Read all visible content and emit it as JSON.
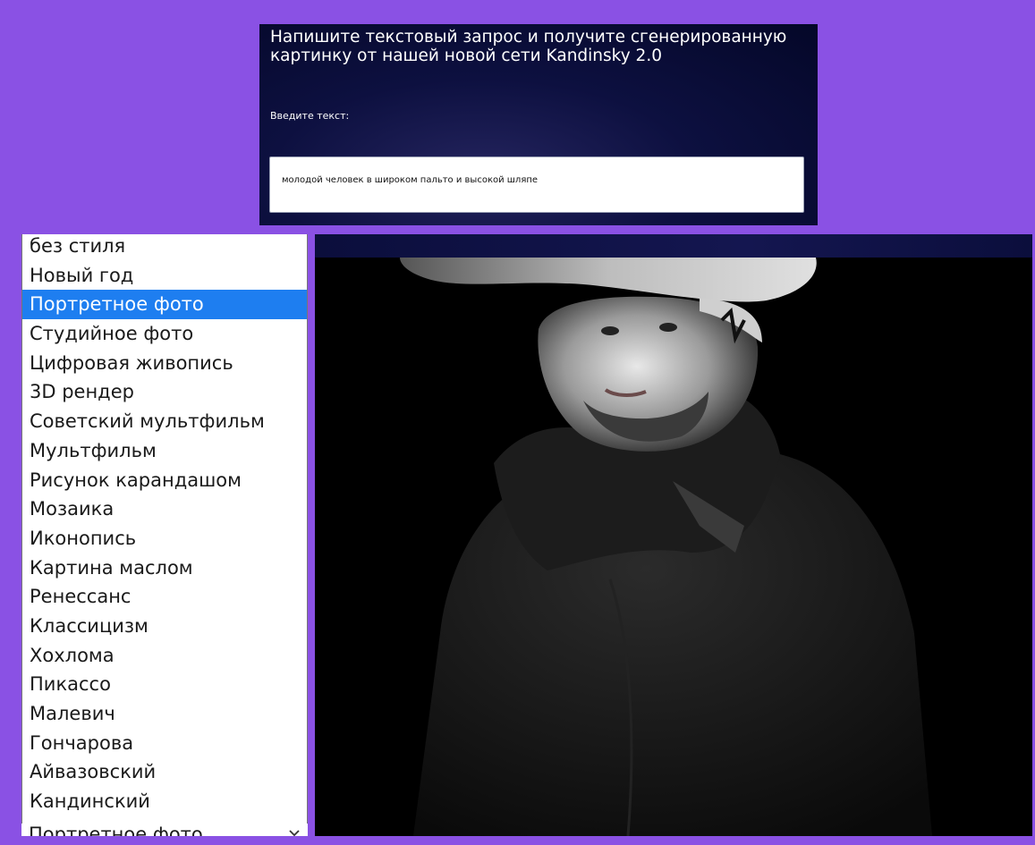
{
  "prompt_panel": {
    "title": "Напишите текстовый запрос и получите сгенерированную картинку от нашей новой сети Kandinsky 2.0",
    "input_label": "Введите текст:",
    "input_value": "молодой человек в широком пальто и высокой шляпе"
  },
  "style_list": {
    "options": [
      "без стиля",
      "Новый год",
      "Портретное фото",
      "Студийное фото",
      "Цифровая живопись",
      "3D рендер",
      "Советский мультфильм",
      "Мультфильм",
      "Рисунок карандашом",
      "Мозаика",
      "Иконопись",
      "Картина маслом",
      "Ренессанс",
      "Классицизм",
      "Хохлома",
      "Пикассо",
      "Малевич",
      "Гончарова",
      "Айвазовский",
      "Кандинский"
    ],
    "selected_index": 2,
    "selected_value": "Портретное фото"
  },
  "colors": {
    "page_background": "#8a51e4",
    "panel_background": "#040728",
    "selection": "#1e7ef0"
  },
  "icons": {
    "select_arrow": "chevron-down-icon"
  }
}
